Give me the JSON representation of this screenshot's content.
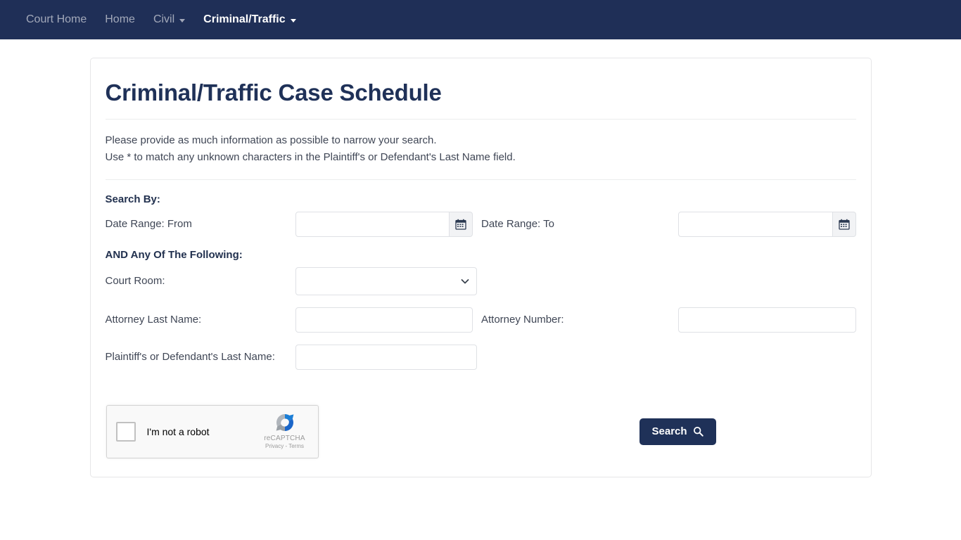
{
  "navbar": {
    "bg_color": "#1f2f57",
    "items": [
      {
        "label": "Court Home",
        "active": false,
        "has_caret": false
      },
      {
        "label": "Home",
        "active": false,
        "has_caret": false
      },
      {
        "label": "Civil",
        "active": false,
        "has_caret": true
      },
      {
        "label": "Criminal/Traffic",
        "active": true,
        "has_caret": true
      }
    ]
  },
  "card": {
    "title": "Criminal/Traffic Case Schedule",
    "title_color": "#1f3158",
    "intro_line1": "Please provide as much information as possible to narrow your search.",
    "intro_line2": "Use * to match any unknown characters in the Plaintiff's or Defendant's Last Name field."
  },
  "form": {
    "search_by_heading": "Search By:",
    "and_any_heading": "AND Any Of The Following:",
    "date_from": {
      "label": "Date Range: From",
      "value": "",
      "placeholder": "",
      "button_icon": "calendar-icon"
    },
    "date_to": {
      "label": "Date Range: To",
      "value": "",
      "placeholder": "",
      "button_icon": "calendar-icon"
    },
    "court_room": {
      "label": "Court Room:",
      "selected": "",
      "options": [
        ""
      ]
    },
    "attorney_last_name": {
      "label": "Attorney Last Name:",
      "value": "",
      "placeholder": ""
    },
    "attorney_number": {
      "label": "Attorney Number:",
      "value": "",
      "placeholder": ""
    },
    "party_last_name": {
      "label": "Plaintiff's or Defendant's Last Name:",
      "value": "",
      "placeholder": ""
    }
  },
  "recaptcha": {
    "checkbox_label": "I'm not a robot",
    "brand": "reCAPTCHA",
    "links": "Privacy - Terms"
  },
  "actions": {
    "search_label": "Search",
    "search_icon": "magnifier-icon",
    "search_bg": "#1f3158"
  }
}
